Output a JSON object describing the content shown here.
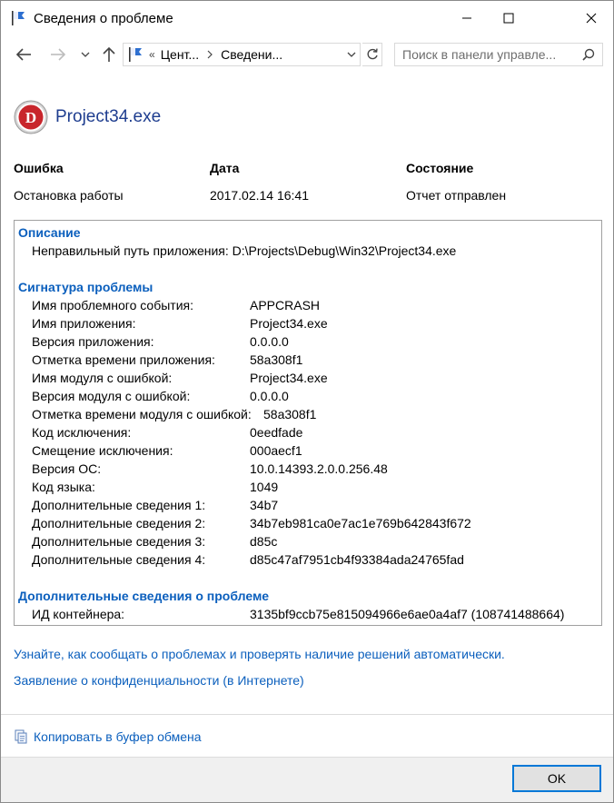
{
  "window": {
    "title": "Сведения о проблеме",
    "accent": "#0078d7",
    "link_color": "#0b5fbd"
  },
  "nav": {
    "back_icon": "arrow-left-icon",
    "forward_icon": "arrow-right-icon",
    "up_icon": "arrow-up-icon",
    "address": {
      "overflow": "«",
      "crumb1": "Цент...",
      "crumb2": "Сведени..."
    },
    "search_placeholder": "Поиск в панели управле..."
  },
  "app": {
    "name": "Project34.exe",
    "logo_letter": "D"
  },
  "summary": {
    "error_label": "Ошибка",
    "error_value": "Остановка работы",
    "date_label": "Дата",
    "date_value": "2017.02.14 16:41",
    "status_label": "Состояние",
    "status_value": "Отчет отправлен"
  },
  "details": {
    "description_title": "Описание",
    "description_text": "Неправильный путь приложения: D:\\Projects\\Debug\\Win32\\Project34.exe",
    "signature_title": "Сигнатура проблемы",
    "signature_rows": [
      {
        "key": "Имя проблемного события:",
        "value": "APPCRASH"
      },
      {
        "key": "Имя приложения:",
        "value": "Project34.exe"
      },
      {
        "key": "Версия приложения:",
        "value": "0.0.0.0"
      },
      {
        "key": "Отметка времени приложения:",
        "value": "58a308f1"
      },
      {
        "key": "Имя модуля с ошибкой:",
        "value": "Project34.exe"
      },
      {
        "key": "Версия модуля с ошибкой:",
        "value": "0.0.0.0"
      },
      {
        "key": "Отметка времени модуля с ошибкой:",
        "value": "58a308f1"
      },
      {
        "key": "Код исключения:",
        "value": "0eedfade"
      },
      {
        "key": "Смещение исключения:",
        "value": "000aecf1"
      },
      {
        "key": "Версия ОС:",
        "value": "10.0.14393.2.0.0.256.48"
      },
      {
        "key": "Код языка:",
        "value": "1049"
      },
      {
        "key": "Дополнительные сведения 1:",
        "value": "34b7"
      },
      {
        "key": "Дополнительные сведения 2:",
        "value": "34b7eb981ca0e7ac1e769b642843f672"
      },
      {
        "key": "Дополнительные сведения 3:",
        "value": "d85c"
      },
      {
        "key": "Дополнительные сведения 4:",
        "value": "d85c47af7951cb4f93384ada24765fad"
      }
    ],
    "extra_title": "Дополнительные сведения о проблеме",
    "extra_key": "ИД контейнера:",
    "extra_value": "3135bf9ccb75e815094966e6ae0a4af7 (108741488664)"
  },
  "links": {
    "learn": "Узнайте, как сообщать о проблемах и проверять наличие решений автоматически.",
    "privacy": "Заявление о конфиденциальности (в Интернете)",
    "copy": "Копировать в буфер обмена"
  },
  "footer": {
    "ok_label": "OK"
  }
}
